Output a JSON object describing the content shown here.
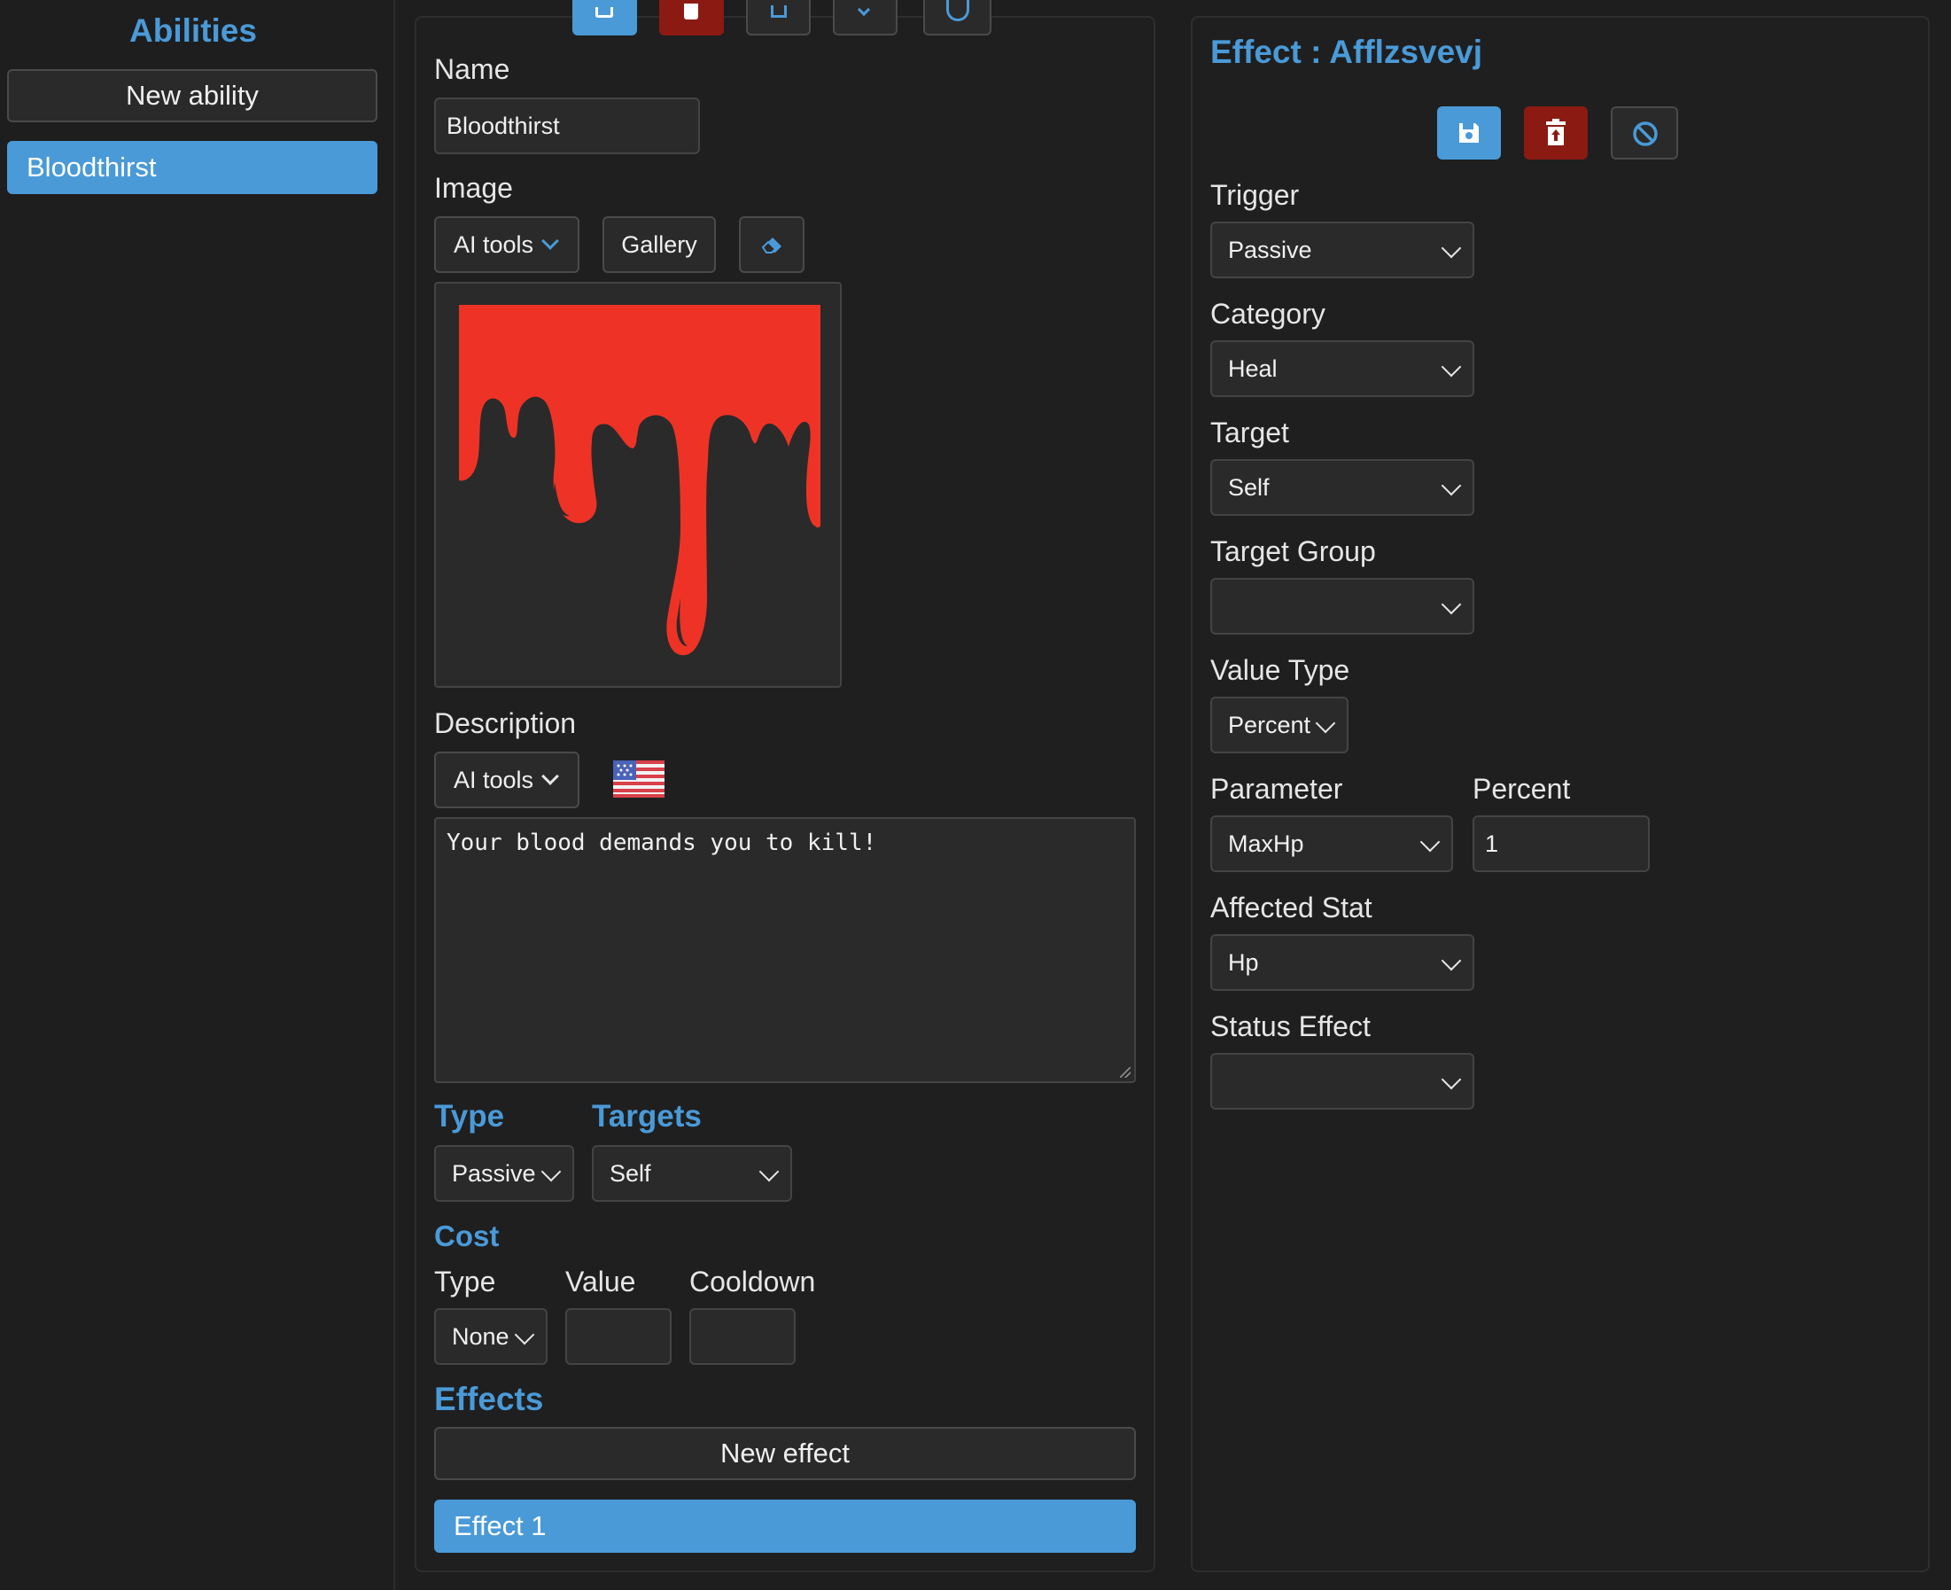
{
  "sidebar": {
    "title": "Abilities",
    "new_button": "New ability",
    "items": [
      {
        "label": "Bloodthirst",
        "selected": true
      }
    ]
  },
  "ability": {
    "name_label": "Name",
    "name_value": "Bloodthirst",
    "image_label": "Image",
    "ai_tools": "AI tools",
    "gallery": "Gallery",
    "image_icon": "blood-drip-icon",
    "description_label": "Description",
    "desc_ai_tools": "AI tools",
    "flag_icon": "us-flag-icon",
    "description_value": "Your blood demands you to kill!",
    "type_label": "Type",
    "type_value": "Passive",
    "targets_label": "Targets",
    "targets_value": "Self",
    "cost_label": "Cost",
    "cost_type_label": "Type",
    "cost_value_label": "Value",
    "cooldown_label": "Cooldown",
    "cost_type_value": "None",
    "cost_value": "",
    "cooldown_value": "",
    "effects_label": "Effects",
    "new_effect": "New effect",
    "effects": [
      {
        "label": "Effect 1",
        "selected": true
      }
    ]
  },
  "effect": {
    "title": "Effect : Afflzsvevj",
    "save_icon": "save-icon",
    "delete_icon": "delete-icon",
    "cancel_icon": "cancel-icon",
    "trigger_label": "Trigger",
    "trigger_value": "Passive",
    "category_label": "Category",
    "category_value": "Heal",
    "target_label": "Target",
    "target_value": "Self",
    "target_group_label": "Target Group",
    "target_group_value": "",
    "value_type_label": "Value Type",
    "value_type_value": "Percent",
    "parameter_label": "Parameter",
    "parameter_value": "MaxHp",
    "percent_label": "Percent",
    "percent_value": "1",
    "affected_stat_label": "Affected Stat",
    "affected_stat_value": "Hp",
    "status_effect_label": "Status Effect",
    "status_effect_value": ""
  },
  "colors": {
    "accent": "#4a9ad8",
    "danger": "#8b1a12",
    "background": "#1e1e1e",
    "panel": "#1f1f1f",
    "blood": "#ee3326"
  }
}
